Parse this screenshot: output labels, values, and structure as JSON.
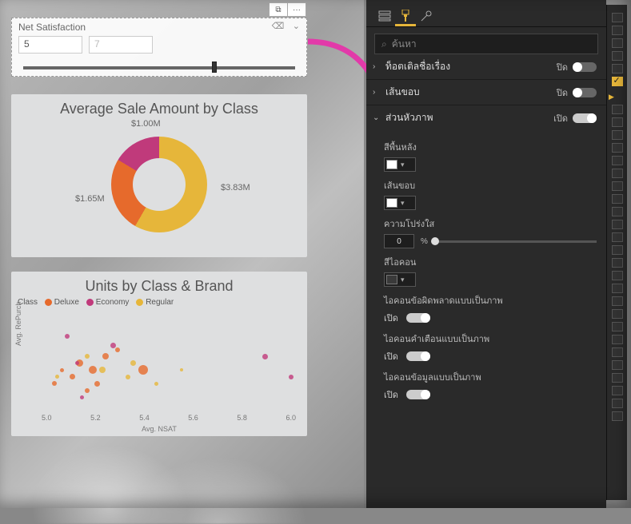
{
  "slicer": {
    "title": "Net Satisfaction",
    "value_from": "5",
    "value_to_placeholder": "7",
    "btn_focus": "⧉",
    "btn_more": "···"
  },
  "donut": {
    "title": "Average Sale Amount by Class",
    "labels": {
      "a": "$1.00M",
      "b": "$1.65M",
      "c": "$3.83M"
    }
  },
  "scatter": {
    "title": "Units by Class & Brand",
    "legend_label": "Class",
    "legend": [
      {
        "name": "Deluxe",
        "color": "#e66a2c"
      },
      {
        "name": "Economy",
        "color": "#c03a7b"
      },
      {
        "name": "Regular",
        "color": "#e6b63a"
      }
    ],
    "xlabel": "Avg. NSAT",
    "ylabel": "Avg. RePurch",
    "xticks": [
      "5.0",
      "5.2",
      "5.4",
      "5.6",
      "5.8",
      "6.0"
    ]
  },
  "format": {
    "search_placeholder": "ค้นหา",
    "sections": {
      "cutoff_top": {
        "label_fragment": "ท็อตเติลชื่อเรื่อง",
        "state": "ปิด"
      },
      "border": {
        "label": "เส้นขอบ",
        "state": "ปิด"
      },
      "header": {
        "label": "ส่วนหัวภาพ",
        "state": "เปิด"
      }
    },
    "header_props": {
      "bg_label": "สีพื้นหลัง",
      "border_label": "เส้นขอบ",
      "trans_label": "ความโปร่งใส",
      "trans_value": "0",
      "trans_pct": "%",
      "iconcolor_label": "สีไอคอน",
      "err_icon_label": "ไอคอนข้อผิดพลาดแบบเป็นภาพ",
      "warn_icon_label": "ไอคอนคำเตือนแบบเป็นภาพ",
      "info_icon_label": "ไอคอนข้อมูลแบบเป็นภาพ",
      "on_label": "เปิด"
    }
  },
  "chart_data": [
    {
      "type": "pie",
      "title": "Average Sale Amount by Class",
      "series": [
        {
          "name": "Regular",
          "value": 3.83,
          "color": "#e6b63a"
        },
        {
          "name": "Deluxe",
          "value": 1.65,
          "color": "#e66a2c"
        },
        {
          "name": "Economy",
          "value": 1.0,
          "color": "#c03a7b"
        }
      ],
      "value_unit": "$M"
    },
    {
      "type": "scatter",
      "title": "Units by Class & Brand",
      "xlabel": "Avg. NSAT",
      "ylabel": "Avg. RePurch",
      "xlim": [
        5.0,
        6.0
      ],
      "series": [
        {
          "name": "Deluxe",
          "color": "#e66a2c",
          "points": [
            [
              5.05,
              4.9,
              6
            ],
            [
              5.08,
              5.0,
              5
            ],
            [
              5.12,
              4.95,
              7
            ],
            [
              5.15,
              5.05,
              9
            ],
            [
              5.18,
              4.85,
              6
            ],
            [
              5.2,
              5.0,
              10
            ],
            [
              5.22,
              4.9,
              7
            ],
            [
              5.25,
              5.1,
              8
            ],
            [
              5.3,
              5.15,
              6
            ],
            [
              5.4,
              5.0,
              12
            ]
          ]
        },
        {
          "name": "Economy",
          "color": "#c03a7b",
          "points": [
            [
              5.1,
              5.25,
              6
            ],
            [
              5.14,
              5.05,
              5
            ],
            [
              5.28,
              5.18,
              7
            ],
            [
              5.16,
              4.8,
              5
            ],
            [
              5.88,
              5.1,
              7
            ],
            [
              5.98,
              4.95,
              6
            ]
          ]
        },
        {
          "name": "Regular",
          "color": "#e6b63a",
          "points": [
            [
              5.06,
              4.95,
              5
            ],
            [
              5.18,
              5.1,
              6
            ],
            [
              5.24,
              5.0,
              8
            ],
            [
              5.34,
              4.95,
              6
            ],
            [
              5.36,
              5.05,
              7
            ],
            [
              5.45,
              4.9,
              5
            ],
            [
              5.55,
              5.0,
              4
            ]
          ]
        }
      ]
    }
  ]
}
